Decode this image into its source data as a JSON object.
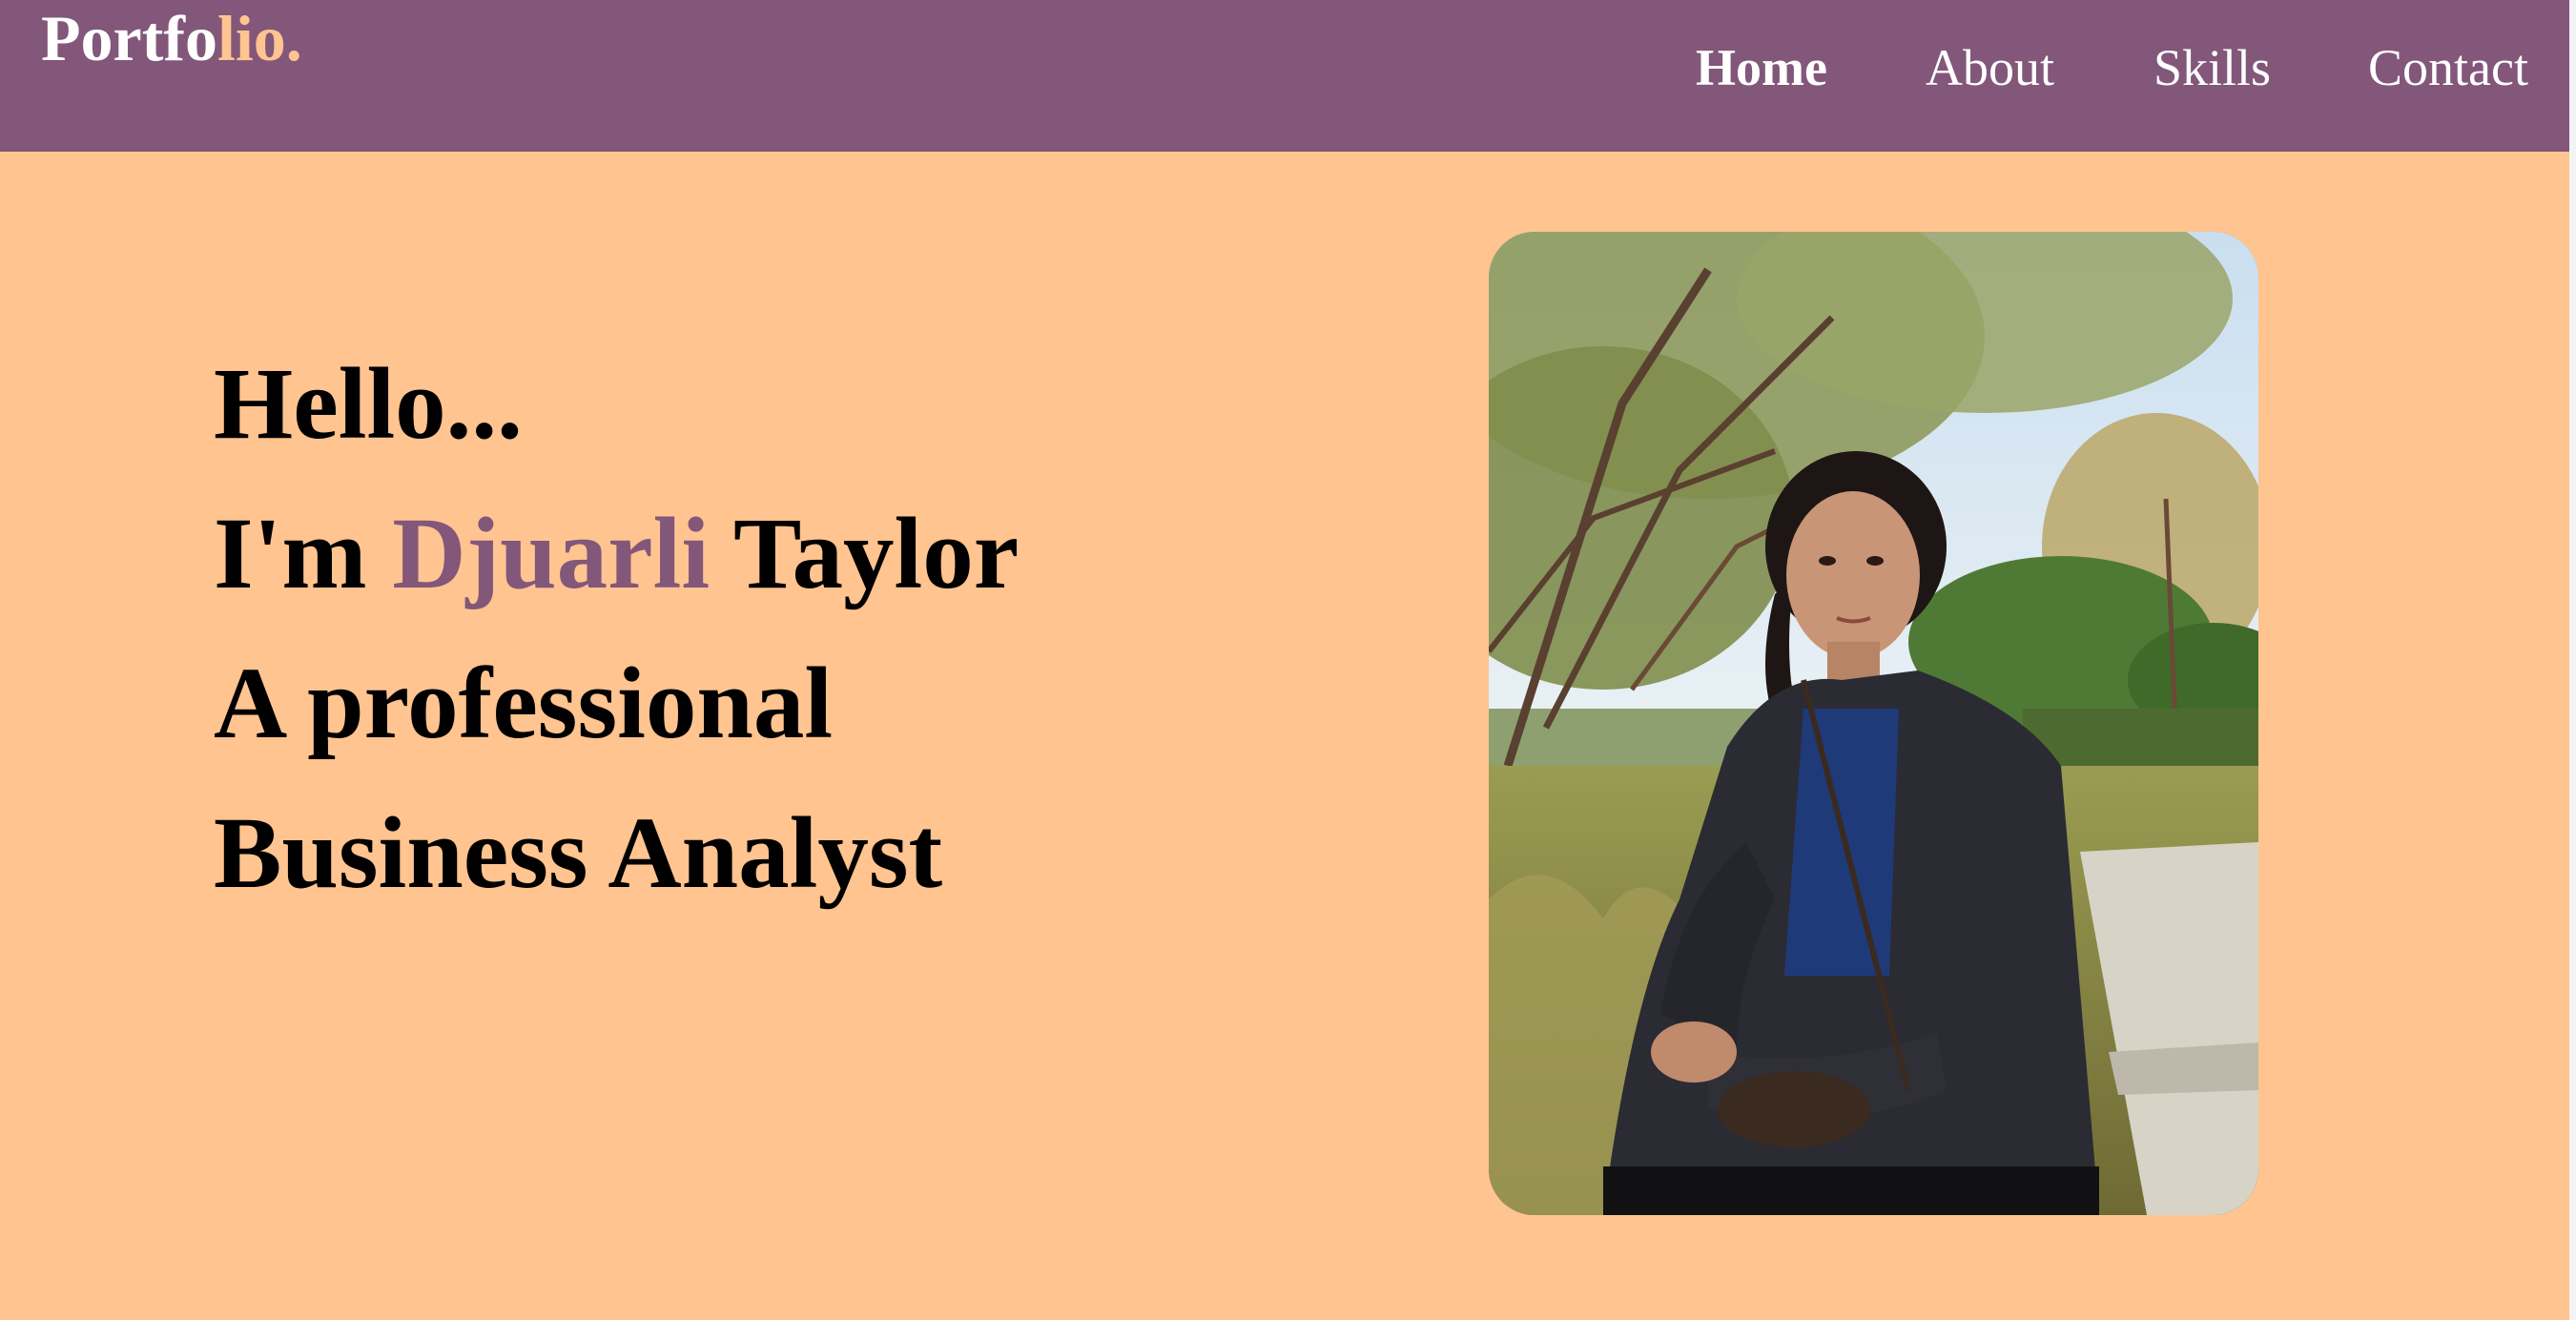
{
  "brand": {
    "logo_main": "Portfo",
    "logo_accent": "lio."
  },
  "nav": {
    "home": "Home",
    "about": "About",
    "skills": "Skills",
    "contact": "Contact"
  },
  "hero": {
    "line1": "Hello...",
    "line2_prefix": "I'm ",
    "line2_highlight": "Djuarli",
    "line2_suffix": " Taylor",
    "line3": "A professional",
    "line4": "Business Analyst"
  },
  "colors": {
    "navbar": "#82577a",
    "background": "#ffc490",
    "accent": "#82577a",
    "logo_accent": "#ffc490"
  },
  "photo": {
    "icon": "portrait-photo"
  }
}
